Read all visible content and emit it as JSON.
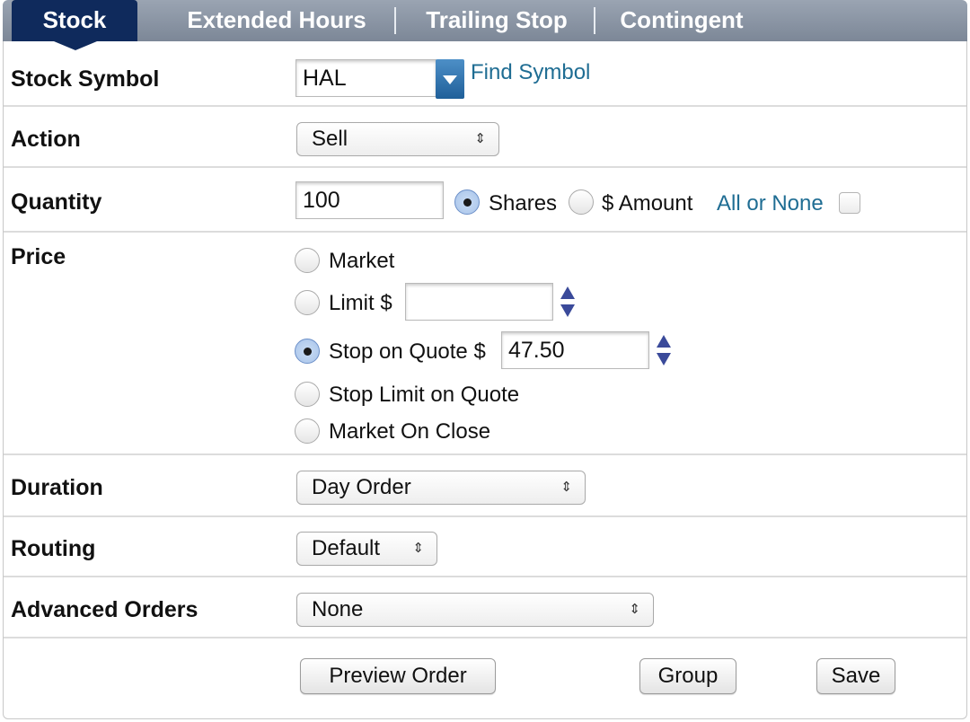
{
  "tabs": [
    {
      "label": "Stock",
      "active": true
    },
    {
      "label": "Extended Hours",
      "active": false
    },
    {
      "label": "Trailing Stop",
      "active": false
    },
    {
      "label": "Contingent",
      "active": false
    }
  ],
  "stock_symbol": {
    "label": "Stock Symbol",
    "value": "HAL",
    "find_link": "Find Symbol"
  },
  "action": {
    "label": "Action",
    "selected": "Sell"
  },
  "quantity": {
    "label": "Quantity",
    "value": "100",
    "shares_label": "Shares",
    "amount_label": "$ Amount",
    "all_or_none_label": "All or None",
    "selected": "Shares"
  },
  "price": {
    "label": "Price",
    "options": [
      {
        "label": "Market",
        "checked": false
      },
      {
        "label": "Limit $",
        "checked": false
      },
      {
        "label": "Stop on Quote $",
        "checked": true
      },
      {
        "label": "Stop Limit on Quote",
        "checked": false
      },
      {
        "label": "Market On Close",
        "checked": false
      }
    ],
    "limit_value": "",
    "stop_value": "47.50"
  },
  "duration": {
    "label": "Duration",
    "selected": "Day Order"
  },
  "routing": {
    "label": "Routing",
    "selected": "Default"
  },
  "advanced_orders": {
    "label": "Advanced Orders",
    "selected": "None"
  },
  "buttons": {
    "preview": "Preview Order",
    "group": "Group",
    "save": "Save"
  },
  "icons": {
    "select_arrows": "⇕"
  },
  "colors": {
    "active_tab": "#0f2a5c",
    "tab_bar": "#8a94a3",
    "link": "#1f6d93",
    "spinner": "#3a4a9a"
  }
}
